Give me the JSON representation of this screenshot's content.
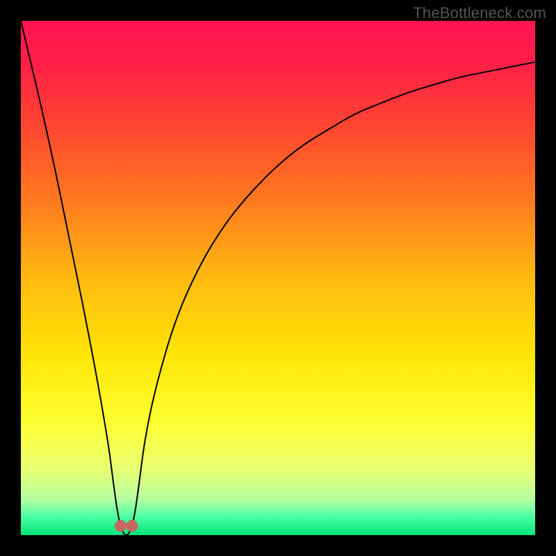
{
  "watermark": "TheBottleneck.com",
  "colors": {
    "black": "#000000",
    "gradient_stops": [
      {
        "offset": 0.0,
        "color": "#ff1451"
      },
      {
        "offset": 0.08,
        "color": "#ff1f48"
      },
      {
        "offset": 0.2,
        "color": "#ff4431"
      },
      {
        "offset": 0.35,
        "color": "#ff7a1f"
      },
      {
        "offset": 0.5,
        "color": "#ffb90f"
      },
      {
        "offset": 0.65,
        "color": "#ffe507"
      },
      {
        "offset": 0.78,
        "color": "#fdff30"
      },
      {
        "offset": 0.87,
        "color": "#e9ff70"
      },
      {
        "offset": 0.93,
        "color": "#b5ffa0"
      },
      {
        "offset": 0.965,
        "color": "#4affa4"
      },
      {
        "offset": 1.0,
        "color": "#00e47a"
      }
    ],
    "curve": "#000000",
    "marker_fill": "#c4695f",
    "marker_stroke": "#c4695f"
  },
  "chart_data": {
    "type": "line",
    "title": "",
    "xlabel": "",
    "ylabel": "",
    "xlim": [
      0,
      100
    ],
    "ylim": [
      0,
      100
    ],
    "series": [
      {
        "name": "bottleneck-percentage-curve",
        "x": [
          0,
          5,
          10,
          14,
          17,
          18,
          19,
          20,
          21,
          22,
          23,
          24,
          26,
          30,
          35,
          40,
          45,
          50,
          55,
          60,
          65,
          70,
          75,
          80,
          85,
          90,
          95,
          100
        ],
        "values": [
          100,
          79,
          55,
          35,
          18,
          10,
          3,
          0,
          0,
          3,
          10,
          18,
          28,
          42,
          53,
          61,
          67,
          72,
          76,
          79,
          82,
          84,
          86,
          87.5,
          89,
          90,
          91,
          92
        ]
      }
    ],
    "markers": {
      "name": "optimal-range-markers",
      "points": [
        {
          "x": 19.4,
          "y": 1.8
        },
        {
          "x": 21.6,
          "y": 1.8
        }
      ],
      "radius_px": 8
    }
  }
}
